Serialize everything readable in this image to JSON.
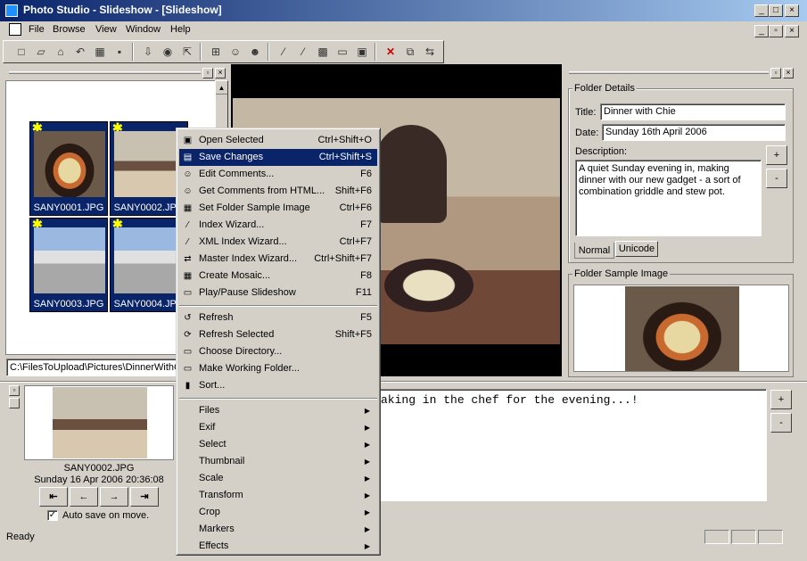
{
  "window": {
    "title": "Photo Studio - Slideshow - [Slideshow]"
  },
  "menubar": [
    "File",
    "Browse",
    "View",
    "Window",
    "Help"
  ],
  "toolbar": {
    "icons": [
      "new-icon",
      "open-icon",
      "scan-icon",
      "undo-icon",
      "thumbnails-icon",
      "save-icon",
      "download-icon",
      "globe-icon",
      "export-icon",
      "select-icon",
      "comment-icon",
      "comment-html-icon",
      "wand-icon",
      "xml-wand-icon",
      "mosaic-icon",
      "slideshow-icon",
      "monitor-icon",
      "delete-icon",
      "copy-icon",
      "move-icon"
    ]
  },
  "thumbnails": [
    {
      "name": "SANY0001.JPG",
      "star": "✱"
    },
    {
      "name": "SANY0002.JPG",
      "star": "✱"
    },
    {
      "name": "SANY0003.JPG",
      "star": "✱"
    },
    {
      "name": "SANY0004.JPG",
      "star": "✱"
    }
  ],
  "path": "C:\\FilesToUpload\\Pictures\\DinnerWithC",
  "folder_details": {
    "header": "Folder Details",
    "title_label": "Title:",
    "title_value": "Dinner with Chie",
    "date_label": "Date:",
    "date_value": "Sunday 16th April 2006",
    "description_label": "Description:",
    "description_value": "A quiet Sunday evening in, making dinner with our new gadget - a sort of combination griddle and stew pot.",
    "tabs": [
      "Normal",
      "Unicode"
    ],
    "sample_header": "Folder Sample Image",
    "plus": "+",
    "minus": "-"
  },
  "preview": {
    "filename": "SANY0002.JPG",
    "timestamp": "Sunday 16 Apr 2006 20:36:08",
    "auto_save": "Auto save on move.",
    "nav": [
      "⇤",
      "←",
      "→",
      "⇥"
    ]
  },
  "comment": "aking in the chef for the evening...!",
  "status": "Ready",
  "context_menu": {
    "items": [
      {
        "label": "Open Selected",
        "shortcut": "Ctrl+Shift+O",
        "icon": "▣"
      },
      {
        "label": "Save Changes",
        "shortcut": "Ctrl+Shift+S",
        "icon": "▤"
      },
      {
        "label": "Edit Comments...",
        "shortcut": "F6",
        "icon": "☺"
      },
      {
        "label": "Get Comments from HTML...",
        "shortcut": "Shift+F6",
        "icon": "☺"
      },
      {
        "label": "Set Folder Sample Image",
        "shortcut": "Ctrl+F6",
        "icon": "▦"
      },
      {
        "label": "Index Wizard...",
        "shortcut": "F7",
        "icon": "⁄"
      },
      {
        "label": "XML Index Wizard...",
        "shortcut": "Ctrl+F7",
        "icon": "⁄"
      },
      {
        "label": "Master Index Wizard...",
        "shortcut": "Ctrl+Shift+F7",
        "icon": "⇄"
      },
      {
        "label": "Create Mosaic...",
        "shortcut": "F8",
        "icon": "▦"
      },
      {
        "label": "Play/Pause Slideshow",
        "shortcut": "F11",
        "icon": "▭"
      }
    ],
    "items2": [
      {
        "label": "Refresh",
        "shortcut": "F5",
        "icon": "↺"
      },
      {
        "label": "Refresh Selected",
        "shortcut": "Shift+F5",
        "icon": "⟳"
      },
      {
        "label": "Choose Directory...",
        "shortcut": "",
        "icon": "▭"
      },
      {
        "label": "Make Working Folder...",
        "shortcut": "",
        "icon": "▭"
      },
      {
        "label": "Sort...",
        "shortcut": "",
        "icon": "▮"
      }
    ],
    "submenus": [
      "Files",
      "Exif",
      "Select",
      "Thumbnail",
      "Scale",
      "Transform",
      "Crop",
      "Markers",
      "Effects"
    ],
    "arrow": "▶"
  },
  "colors": {
    "titlebar": "#0a246a",
    "selection": "#0a246a",
    "panel": "#d4d0c8"
  }
}
